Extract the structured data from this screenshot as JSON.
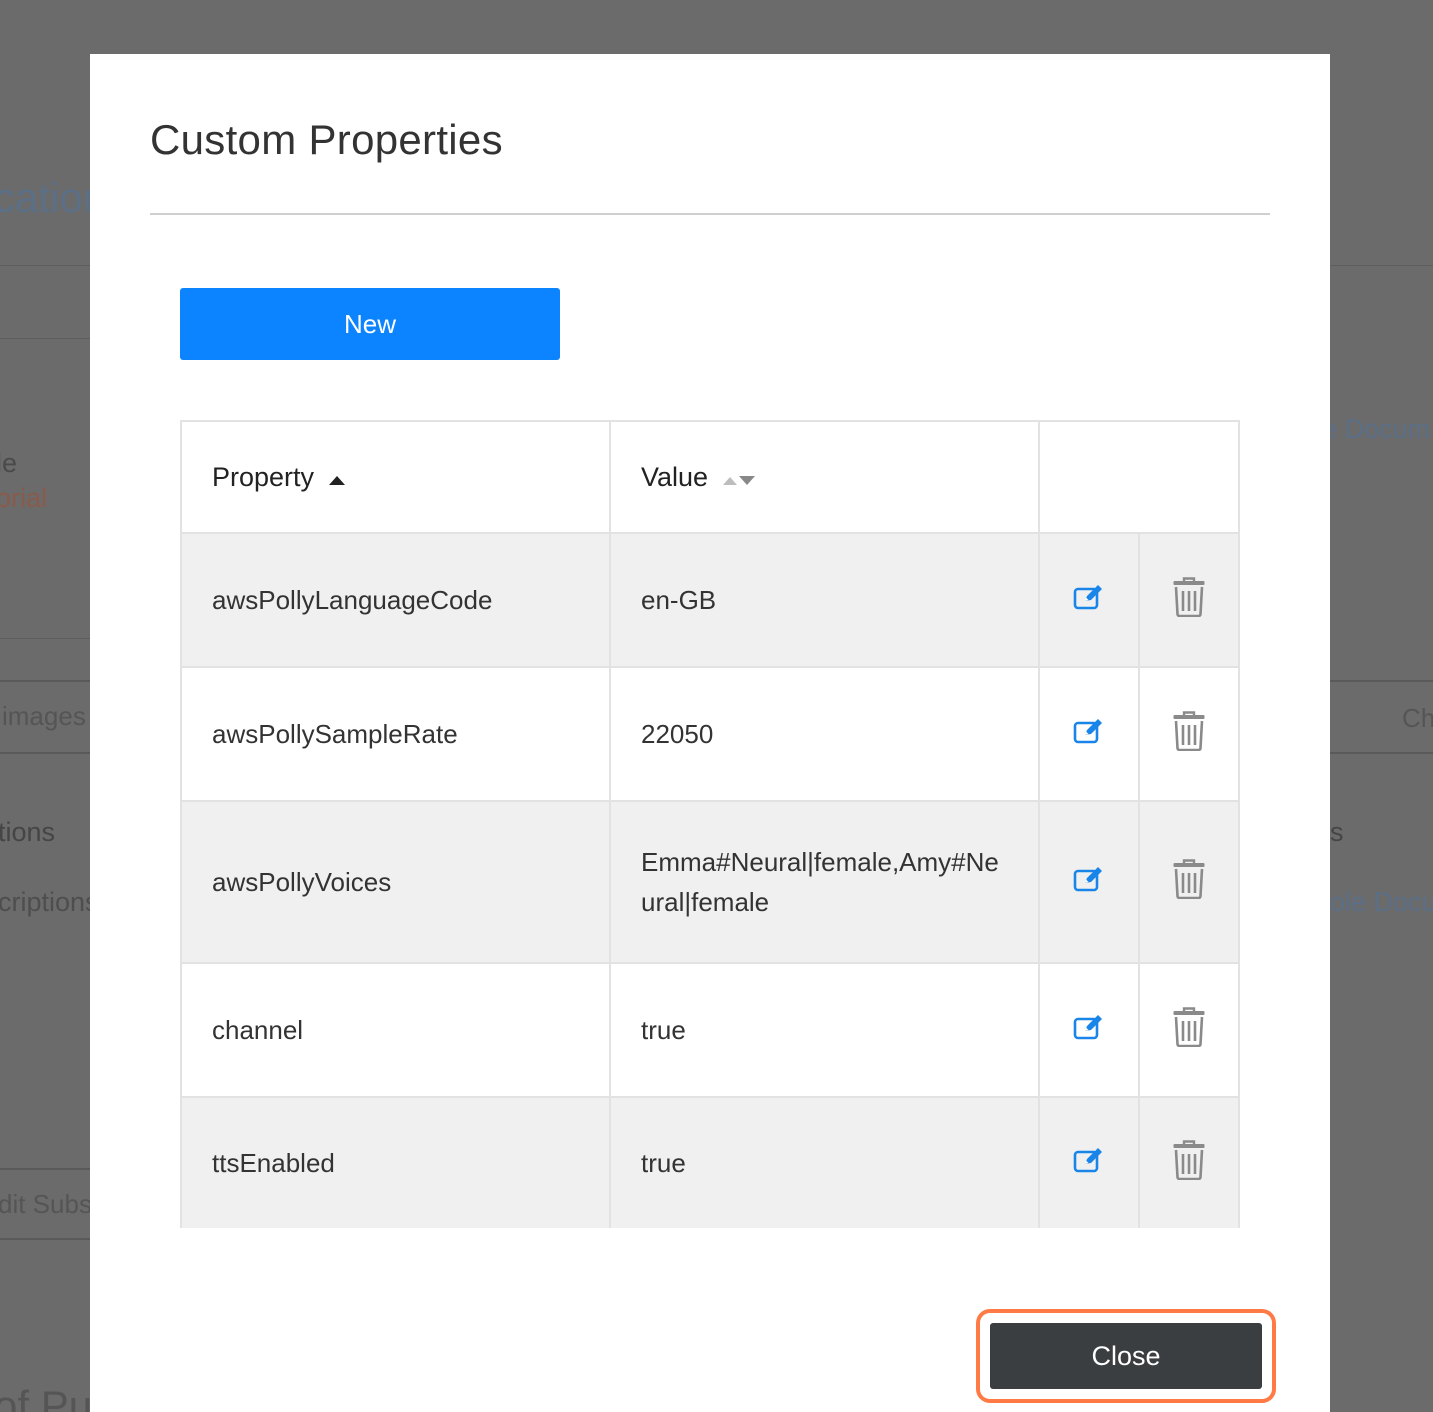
{
  "background": {
    "fragments": [
      "cation",
      "le",
      "orial",
      "images",
      "tions",
      "criptions",
      "dit Subs",
      "of Pu",
      "e Docum",
      "Ch",
      "s",
      "ole Docu"
    ]
  },
  "modal": {
    "title": "Custom Properties",
    "new_button_label": "New",
    "close_button_label": "Close"
  },
  "table": {
    "headers": {
      "property": "Property",
      "value": "Value"
    },
    "sort": {
      "property": "ascending",
      "value": "unsorted"
    },
    "rows": [
      {
        "property": "awsPollyLanguageCode",
        "value": "en-GB"
      },
      {
        "property": "awsPollySampleRate",
        "value": "22050"
      },
      {
        "property": "awsPollyVoices",
        "value": "Emma#Neural|female,Amy#Neural|female"
      },
      {
        "property": "channel",
        "value": "true"
      },
      {
        "property": "ttsEnabled",
        "value": "true"
      }
    ]
  },
  "colors": {
    "primary": "#0d84ff",
    "close_button": "#3b3e40",
    "highlight": "#ff7a45",
    "overlay": "#6b6b6b",
    "row_alt": "#f0f0f0"
  },
  "icons": {
    "edit": "edit-icon",
    "delete": "trash-icon",
    "sort_asc": "sort-ascending-icon",
    "sort_both": "sort-both-icon"
  }
}
